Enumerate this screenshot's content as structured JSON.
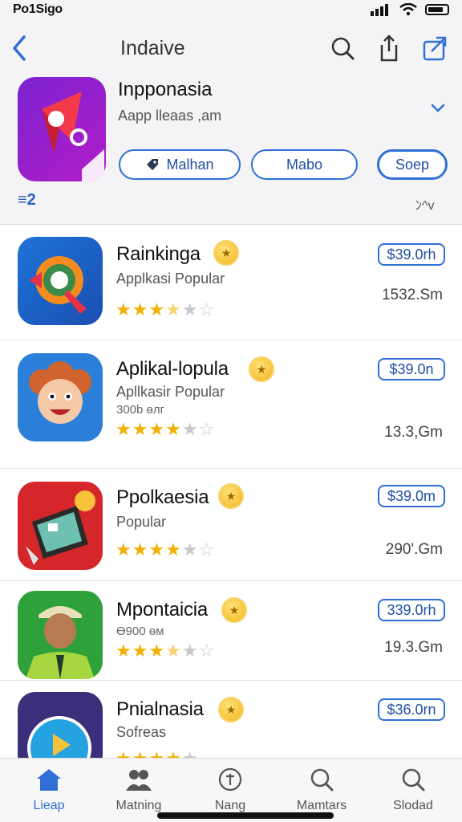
{
  "status": {
    "time": "Po1Sigo"
  },
  "nav": {
    "title": "Indaive"
  },
  "app": {
    "name": "Inpponasia",
    "subtitle": "Aapp lleaas ,am"
  },
  "filters": [
    {
      "label": "Malhan"
    },
    {
      "label": "Mabo"
    },
    {
      "label": "Soep"
    }
  ],
  "sort": {
    "left_label": "≡2",
    "right_label": "ﾝ^v"
  },
  "rows": [
    {
      "title": "Rainkinga",
      "sub": "Applkasi Popular",
      "sub2": "",
      "rating": 3.5,
      "price": "$39.0rh",
      "size": "1532.Sm",
      "accent": "#1e73d8"
    },
    {
      "title": "Aplikal-lopula",
      "sub": "Apllkasir Popular",
      "sub2": "300b өлг",
      "rating": 4,
      "price": "$39.0n",
      "size": "13.3,Gm",
      "accent": "#2b7fd9"
    },
    {
      "title": "Ppolkaesia",
      "sub": "Popular",
      "sub2": "",
      "rating": 4,
      "price": "$39.0m",
      "size": "290'.Gm",
      "accent": "#d5262b"
    },
    {
      "title": "Mpontaicia",
      "sub": "",
      "sub2": "Ө900 өм",
      "rating": 3.5,
      "price": "339.0rh",
      "size": "19.3.Gm",
      "accent": "#2ea13b"
    },
    {
      "title": "Pnialnasia",
      "sub": "Sofreas",
      "sub2": "",
      "rating": 4,
      "price": "$36.0rn",
      "size": "",
      "accent": "#3a2f7a"
    }
  ],
  "tabs": [
    {
      "label": "Lieap",
      "icon": "home-icon"
    },
    {
      "label": "Matning",
      "icon": "people-icon"
    },
    {
      "label": "Nang",
      "icon": "plus-icon"
    },
    {
      "label": "Mamtars",
      "icon": "search-icon"
    },
    {
      "label": "Slodad",
      "icon": "search-icon"
    }
  ]
}
